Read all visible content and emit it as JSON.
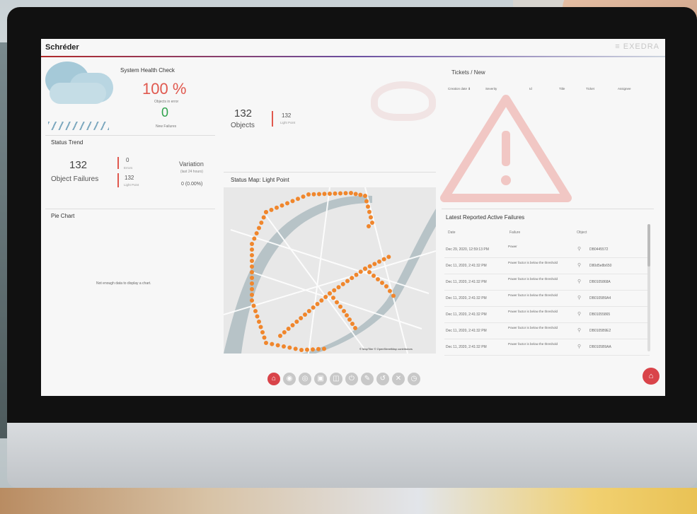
{
  "topbar": {
    "brand": "Schréder",
    "right_text": "≡ EXEDRA"
  },
  "health": {
    "title": "System Health Check",
    "percent": "100 %",
    "percent_sub": "Objects in error",
    "zero": "0",
    "zero_sub": "New Failures"
  },
  "trend": {
    "title": "Status Trend",
    "count": "132",
    "label": "Object Failures",
    "mini1_num": "0",
    "mini1_lbl": "Errors",
    "mini2_num": "132",
    "mini2_lbl": "Light Point",
    "variation_title": "Variation",
    "variation_sub": "(last 24 hours)",
    "variation_value": "0 (0.00%)"
  },
  "pie": {
    "title": "Pie Chart",
    "message": "Not enough data to display a chart."
  },
  "objects": {
    "count": "132",
    "label": "Objects",
    "mini_num": "132",
    "mini_lbl": "Light Point"
  },
  "map": {
    "title": "Status Map: Light Point",
    "attribution": "© MapTiler © OpenStreetMap contributors"
  },
  "tickets": {
    "title": "Tickets / New",
    "columns": [
      "Creation date ⬇",
      "Severity",
      "Id",
      "Title",
      "Ticket",
      "Assignee"
    ]
  },
  "failures": {
    "title": "Latest Reported Active Failures",
    "columns": [
      "Date",
      "Failure",
      "Object"
    ],
    "rows": [
      {
        "date": "Dec 29, 2020, 12:59:13 PM",
        "msg": "Power",
        "id": "DB0445572"
      },
      {
        "date": "Dec 11, 2020, 2:41:32 PM",
        "msg": "Power factor is below the threshold",
        "id": "D80d5e8b650"
      },
      {
        "date": "Dec 11, 2020, 2:41:32 PM",
        "msg": "Power factor is below the threshold",
        "id": "DB0105868A"
      },
      {
        "date": "Dec 11, 2020, 2:41:32 PM",
        "msg": "Power factor is below the threshold",
        "id": "DB0105B9A4"
      },
      {
        "date": "Dec 11, 2020, 2:41:32 PM",
        "msg": "Power factor is below the threshold",
        "id": "DB01055865"
      },
      {
        "date": "Dec 11, 2020, 2:41:32 PM",
        "msg": "Power factor is below the threshold",
        "id": "DB0105B9E2"
      },
      {
        "date": "Dec 11, 2020, 2:41:32 PM",
        "msg": "Power factor is below the threshold",
        "id": "DB0105B9AA"
      }
    ]
  },
  "dock": [
    "⌂",
    "◉",
    "◎",
    "▣",
    "◫",
    "⏻",
    "✎",
    "↺",
    "✕",
    "◷"
  ],
  "fab_icon": "⌂"
}
